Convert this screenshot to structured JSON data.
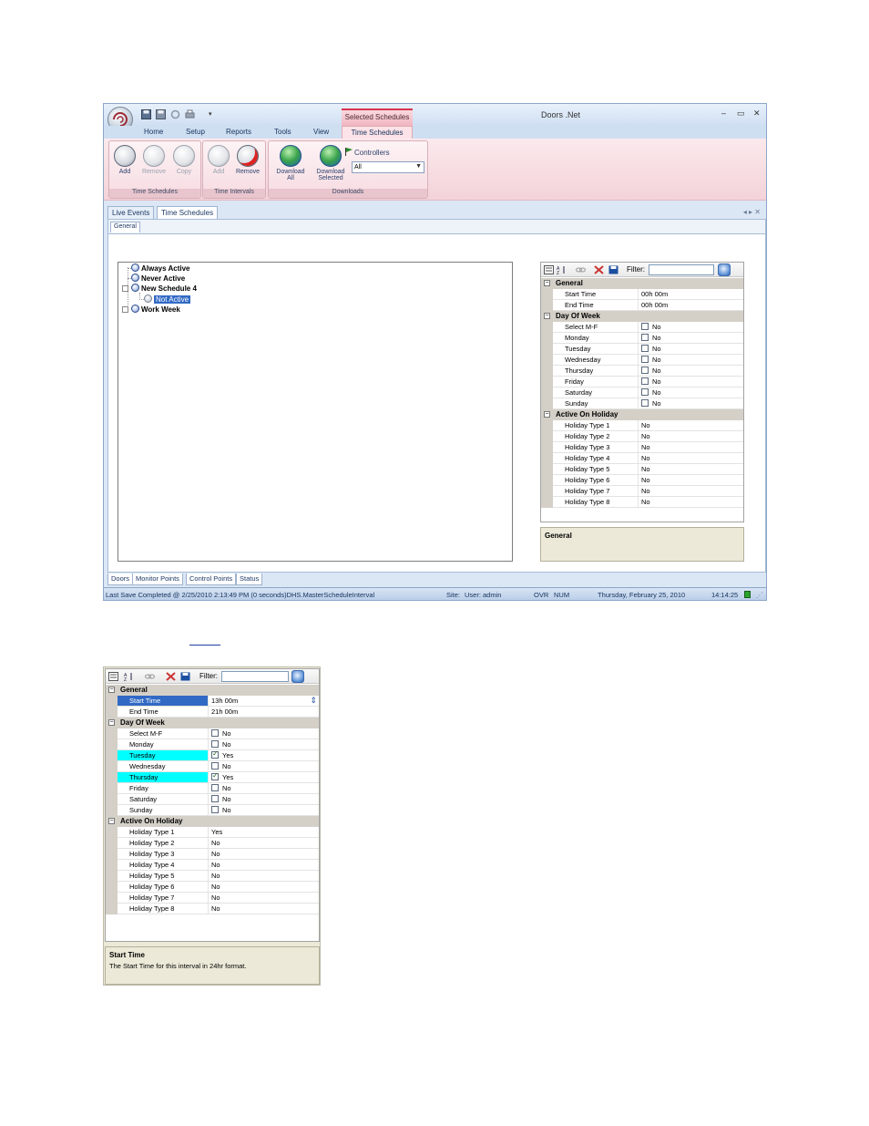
{
  "window": {
    "title": "Doors .Net",
    "context_title": "Selected Schedules",
    "controls": [
      "–",
      "▭",
      "✕"
    ]
  },
  "ribbon_tabs": [
    "Home",
    "Setup",
    "Reports",
    "Tools",
    "View",
    "Time Schedules"
  ],
  "ribbon": {
    "time_schedules": {
      "label": "Time Schedules",
      "buttons": [
        "Add",
        "Remove",
        "Copy"
      ]
    },
    "time_intervals": {
      "label": "Time Intervals",
      "buttons": [
        "Add",
        "Remove"
      ]
    },
    "downloads": {
      "label": "Downloads",
      "download_all": [
        "Download",
        "All"
      ],
      "download_selected": [
        "Download",
        "Selected"
      ],
      "controllers_label": "Controllers",
      "controllers_value": "All"
    }
  },
  "doc_tabs": [
    "Live Events",
    "Time Schedules"
  ],
  "sub_tab": "General",
  "tree": {
    "nodes": [
      "Always Active",
      "Never Active",
      "New Schedule 4",
      "Work Week"
    ],
    "child": "Not Active"
  },
  "grid1": {
    "filter_label": "Filter:",
    "categories": {
      "general": "General",
      "day_of_week": "Day Of Week",
      "holiday": "Active On Holiday"
    },
    "general_rows": [
      {
        "name": "Start Time",
        "value": "00h 00m"
      },
      {
        "name": "End Time",
        "value": "00h 00m"
      }
    ],
    "day_rows": [
      {
        "name": "Select M-F",
        "value": "No"
      },
      {
        "name": "Monday",
        "value": "No"
      },
      {
        "name": "Tuesday",
        "value": "No"
      },
      {
        "name": "Wednesday",
        "value": "No"
      },
      {
        "name": "Thursday",
        "value": "No"
      },
      {
        "name": "Friday",
        "value": "No"
      },
      {
        "name": "Saturday",
        "value": "No"
      },
      {
        "name": "Sunday",
        "value": "No"
      }
    ],
    "holiday_rows": [
      {
        "name": "Holiday Type 1",
        "value": "No"
      },
      {
        "name": "Holiday Type 2",
        "value": "No"
      },
      {
        "name": "Holiday Type 3",
        "value": "No"
      },
      {
        "name": "Holiday Type 4",
        "value": "No"
      },
      {
        "name": "Holiday Type 5",
        "value": "No"
      },
      {
        "name": "Holiday Type 6",
        "value": "No"
      },
      {
        "name": "Holiday Type 7",
        "value": "No"
      },
      {
        "name": "Holiday Type 8",
        "value": "No"
      }
    ],
    "description_title": "General"
  },
  "bottom_tabs": [
    "Doors",
    "Monitor Points",
    "Control Points",
    "Status"
  ],
  "status": {
    "last_save": "Last Save Completed @ 2/25/2010 2:13:49 PM (0 seconds)DHS.MasterScheduleInterval",
    "site": "Site:",
    "user": "User: admin",
    "ovr": "OVR",
    "num": "NUM",
    "date": "Thursday, February 25, 2010",
    "time": "14:14:25"
  },
  "grid2": {
    "filter_label": "Filter:",
    "categories": {
      "general": "General",
      "day_of_week": "Day Of Week",
      "holiday": "Active On Holiday"
    },
    "general_rows": [
      {
        "name": "Start Time",
        "value": "13h 00m"
      },
      {
        "name": "End Time",
        "value": "21h 00m"
      }
    ],
    "day_rows": [
      {
        "name": "Select M-F",
        "value": "No",
        "checked": false
      },
      {
        "name": "Monday",
        "value": "No",
        "checked": false
      },
      {
        "name": "Tuesday",
        "value": "Yes",
        "checked": true
      },
      {
        "name": "Wednesday",
        "value": "No",
        "checked": false
      },
      {
        "name": "Thursday",
        "value": "Yes",
        "checked": true
      },
      {
        "name": "Friday",
        "value": "No",
        "checked": false
      },
      {
        "name": "Saturday",
        "value": "No",
        "checked": false
      },
      {
        "name": "Sunday",
        "value": "No",
        "checked": false
      }
    ],
    "holiday_rows": [
      {
        "name": "Holiday Type 1",
        "value": "Yes"
      },
      {
        "name": "Holiday Type 2",
        "value": "No"
      },
      {
        "name": "Holiday Type 3",
        "value": "No"
      },
      {
        "name": "Holiday Type 4",
        "value": "No"
      },
      {
        "name": "Holiday Type 5",
        "value": "No"
      },
      {
        "name": "Holiday Type 6",
        "value": "No"
      },
      {
        "name": "Holiday Type 7",
        "value": "No"
      },
      {
        "name": "Holiday Type 8",
        "value": "No"
      }
    ],
    "description_title": "Start Time",
    "description_text": "The Start Time for this interval in 24hr format."
  },
  "colors": {
    "selected_row": "#316ac5",
    "highlight_day": "#00ffff",
    "category_bg": "#d4d0c8",
    "ribbon_pink": "#f3d3d9"
  }
}
